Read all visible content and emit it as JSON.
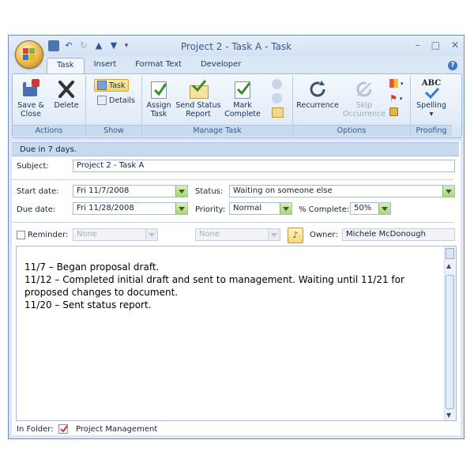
{
  "window": {
    "title": "Project 2 - Task A - Task",
    "controls": [
      "–",
      "□",
      "✕"
    ]
  },
  "tabs": [
    {
      "label": "Task",
      "active": true
    },
    {
      "label": "Insert",
      "active": false
    },
    {
      "label": "Format Text",
      "active": false
    },
    {
      "label": "Developer",
      "active": false
    }
  ],
  "ribbon": {
    "actions": {
      "label": "Actions",
      "save_close": "Save &\nClose",
      "delete": "Delete"
    },
    "show": {
      "label": "Show",
      "task": "Task",
      "details": "Details"
    },
    "manage": {
      "label": "Manage Task",
      "assign": "Assign\nTask",
      "send_status": "Send Status\nReport",
      "mark_complete": "Mark\nComplete"
    },
    "options": {
      "label": "Options",
      "recurrence": "Recurrence",
      "skip": "Skip\nOccurrence"
    },
    "proofing": {
      "label": "Proofing",
      "spelling": "Spelling"
    }
  },
  "info_bar": "Due in 7 days.",
  "form": {
    "subject_label": "Subject:",
    "subject_value": "Project 2 - Task A",
    "start_label": "Start date:",
    "start_value": "Fri 11/7/2008",
    "due_label": "Due date:",
    "due_value": "Fri 11/28/2008",
    "status_label": "Status:",
    "status_value": "Waiting on someone else",
    "priority_label": "Priority:",
    "priority_value": "Normal",
    "complete_label": "% Complete:",
    "complete_value": "50%",
    "reminder_label": "Reminder:",
    "reminder_date": "None",
    "reminder_time": "None",
    "owner_label": "Owner:",
    "owner_value": "Michele McDonough"
  },
  "notes": [
    "11/7 – Began proposal draft.",
    "11/12 – Completed initial draft and sent to management. Waiting until 11/21 for proposed changes to document.",
    "11/20 – Sent status report."
  ],
  "folder": {
    "label": "In Folder:",
    "value": "Project Management"
  },
  "colors": {
    "ribbon_bg": "#e3ecf8",
    "accent": "#3f77c7",
    "dropdown_green": "#a9d37d",
    "info_bar": "#c7daf0"
  }
}
